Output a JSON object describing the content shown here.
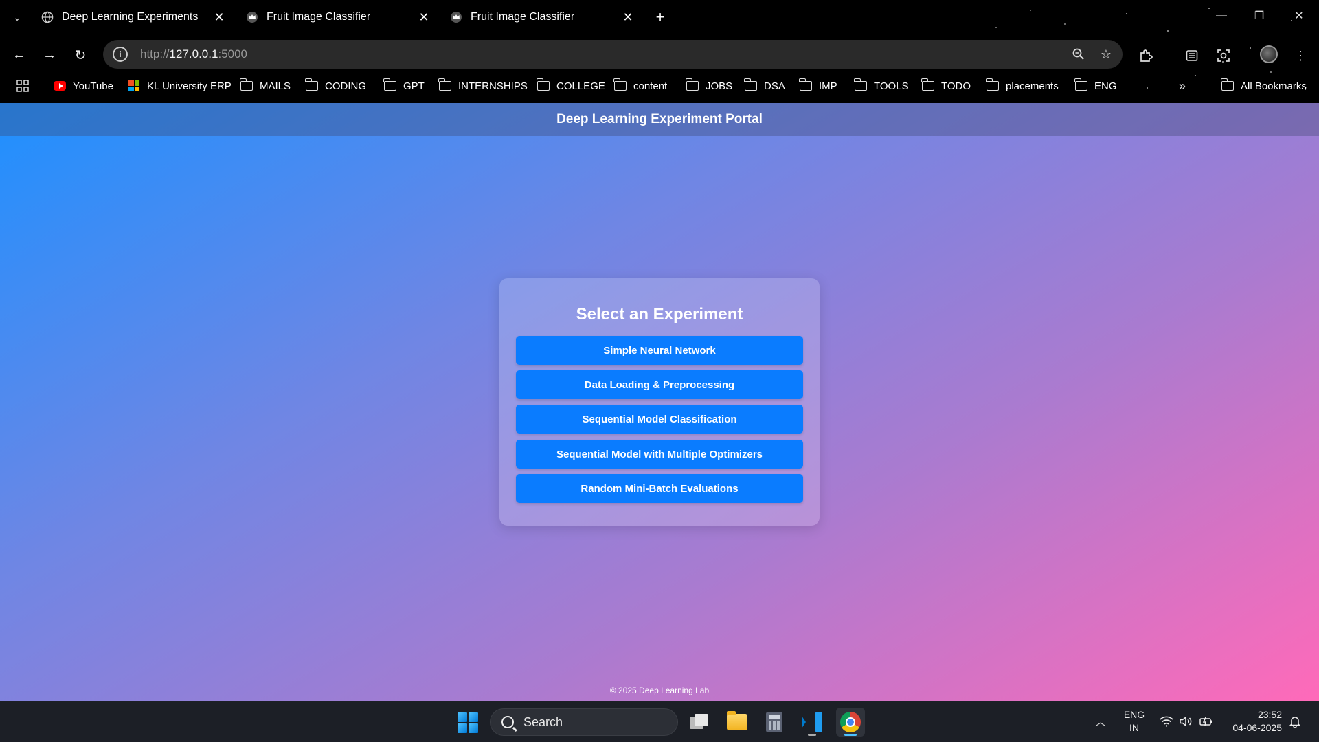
{
  "browser": {
    "tabs": [
      {
        "title": "Deep Learning Experiments",
        "favicon": "globe-icon"
      },
      {
        "title": "Fruit Image Classifier",
        "favicon": "crown-icon"
      },
      {
        "title": "Fruit Image Classifier",
        "favicon": "crown-icon"
      }
    ],
    "url_scheme": "http://",
    "url_host": "127.0.0.1",
    "url_port": ":5000",
    "bookmarks": [
      {
        "label": "YouTube",
        "icon": "youtube-icon"
      },
      {
        "label": "KL University ERP",
        "icon": "grid-logo-icon"
      },
      {
        "label": "MAILS",
        "icon": "folder-icon"
      },
      {
        "label": "CODING",
        "icon": "folder-icon"
      },
      {
        "label": "GPT",
        "icon": "folder-icon"
      },
      {
        "label": "INTERNSHIPS",
        "icon": "folder-icon"
      },
      {
        "label": "COLLEGE",
        "icon": "folder-icon"
      },
      {
        "label": "content",
        "icon": "folder-icon"
      },
      {
        "label": "JOBS",
        "icon": "folder-icon"
      },
      {
        "label": "DSA",
        "icon": "folder-icon"
      },
      {
        "label": "IMP",
        "icon": "folder-icon"
      },
      {
        "label": "TOOLS",
        "icon": "folder-icon"
      },
      {
        "label": "TODO",
        "icon": "folder-icon"
      },
      {
        "label": "placements",
        "icon": "folder-icon"
      },
      {
        "label": "ENG",
        "icon": "folder-icon"
      }
    ],
    "all_bookmarks_label": "All Bookmarks"
  },
  "page": {
    "header_title": "Deep Learning Experiment Portal",
    "card_title": "Select an Experiment",
    "experiments": [
      "Simple Neural Network",
      "Data Loading & Preprocessing",
      "Sequential Model Classification",
      "Sequential Model with Multiple Optimizers",
      "Random Mini-Batch Evaluations"
    ],
    "footer": "© 2025 Deep Learning Lab",
    "colors": {
      "button": "#0a7cff",
      "gradient_start": "#1e90ff",
      "gradient_end": "#ff6ab9"
    }
  },
  "taskbar": {
    "search_label": "Search",
    "lang_line1": "ENG",
    "lang_line2": "IN",
    "time": "23:52",
    "date": "04-06-2025"
  }
}
